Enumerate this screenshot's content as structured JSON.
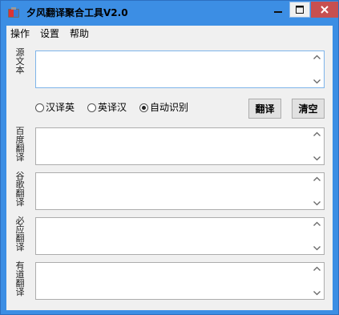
{
  "window": {
    "title": "夕风翻译聚合工具V2.0",
    "icon": "app-icon"
  },
  "menu": [
    {
      "label": "操作"
    },
    {
      "label": "设置"
    },
    {
      "label": "帮助"
    }
  ],
  "source": {
    "label": "源文本",
    "value": ""
  },
  "options": [
    {
      "label": "汉译英",
      "checked": false
    },
    {
      "label": "英译汉",
      "checked": false
    },
    {
      "label": "自动识别",
      "checked": true
    }
  ],
  "buttons": {
    "translate": "翻译",
    "clear": "清空"
  },
  "results": [
    {
      "label": "百度翻译",
      "value": ""
    },
    {
      "label": "谷歌翻译",
      "value": ""
    },
    {
      "label": "必应翻译",
      "value": ""
    },
    {
      "label": "有道翻译",
      "value": ""
    }
  ],
  "colors": {
    "titlebar": "#3c8ee4",
    "close": "#c75050",
    "focus_border": "#7eb4ea"
  }
}
